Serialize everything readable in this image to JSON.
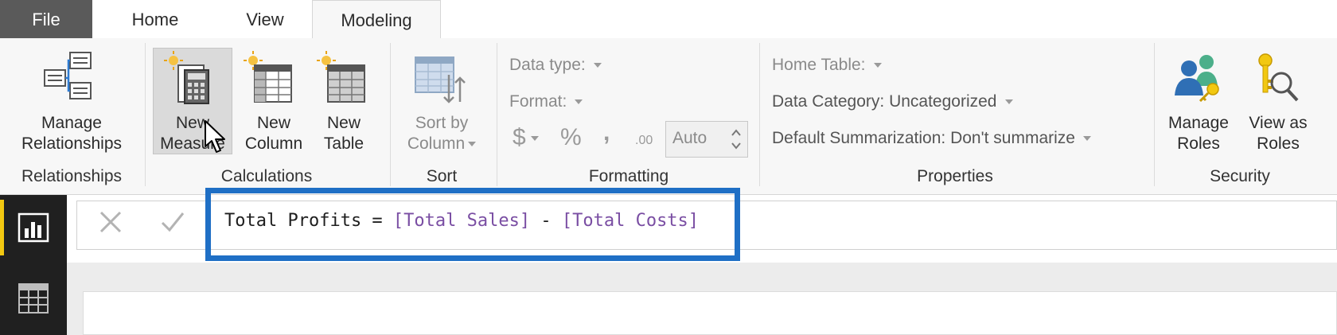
{
  "tabs": {
    "file": "File",
    "home": "Home",
    "view": "View",
    "modeling": "Modeling"
  },
  "ribbon": {
    "relationships": {
      "manage_line1": "Manage",
      "manage_line2": "Relationships",
      "group": "Relationships"
    },
    "calculations": {
      "new_measure_line1": "New",
      "new_measure_line2": "Measure",
      "new_column_line1": "New",
      "new_column_line2": "Column",
      "new_table_line1": "New",
      "new_table_line2": "Table",
      "group": "Calculations"
    },
    "sort": {
      "sort_line1": "Sort by",
      "sort_line2": "Column",
      "group": "Sort"
    },
    "formatting": {
      "data_type": "Data type:",
      "format": "Format:",
      "currency": "$",
      "percent": "%",
      "comma": ",",
      "decimal": ".00",
      "auto": "Auto",
      "group": "Formatting"
    },
    "properties": {
      "home_table": "Home Table:",
      "data_category": "Data Category: Uncategorized",
      "default_summarization": "Default Summarization: Don't summarize",
      "group": "Properties"
    },
    "security": {
      "manage_roles_line1": "Manage",
      "manage_roles_line2": "Roles",
      "view_as_line1": "View as",
      "view_as_line2": "Roles",
      "group": "Security"
    }
  },
  "formula_bar": {
    "cancel_icon": "x-icon",
    "commit_icon": "check-icon",
    "formula_name": "Total Profits = ",
    "ref1": "[Total Sales]",
    "operator": " - ",
    "ref2": "[Total Costs]"
  },
  "leftnav": {
    "report_icon": "bar-chart-icon",
    "data_icon": "table-grid-icon"
  },
  "colors": {
    "highlight": "#1f6fc5",
    "measure_ref": "#7a4ea3",
    "nav_active": "#f2c811"
  }
}
